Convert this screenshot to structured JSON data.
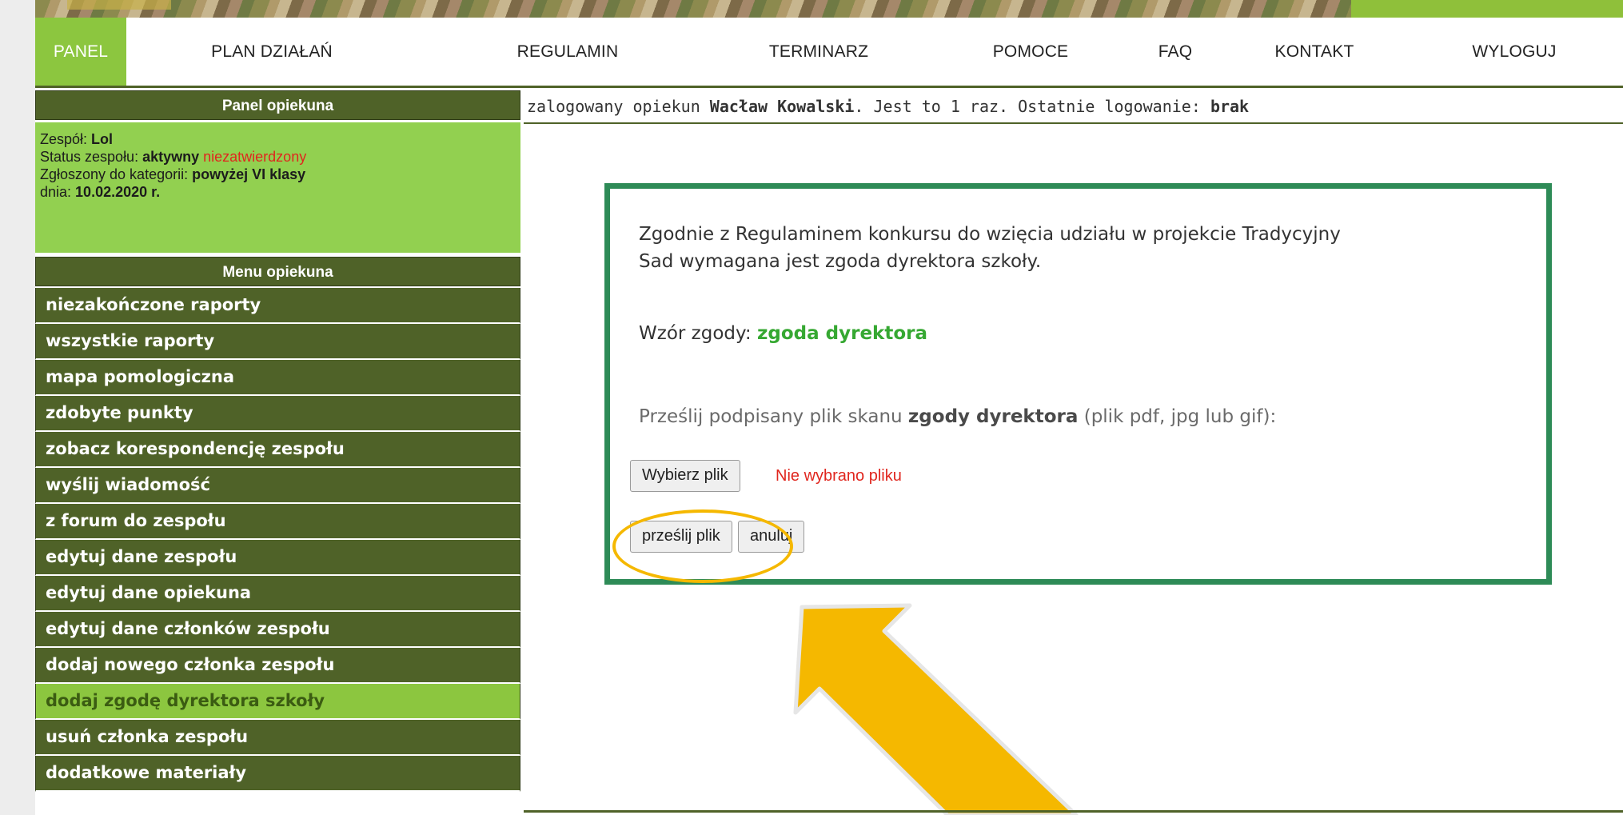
{
  "nav": {
    "items": [
      {
        "label": "PANEL",
        "active": true
      },
      {
        "label": "PLAN DZIAŁAŃ",
        "active": false
      },
      {
        "label": "REGULAMIN",
        "active": false
      },
      {
        "label": "TERMINARZ",
        "active": false
      },
      {
        "label": "POMOCE",
        "active": false
      },
      {
        "label": "FAQ",
        "active": false
      },
      {
        "label": "KONTAKT",
        "active": false
      },
      {
        "label": "WYLOGUJ",
        "active": false
      }
    ]
  },
  "sidebar": {
    "panel_title": "Panel opiekuna",
    "team_label": "Zespół: ",
    "team_name": "Lol",
    "status_label": "Status zespołu: ",
    "status_active": "aktywny",
    "status_unconfirmed": "niezatwierdzony",
    "category_label": "Zgłoszony do kategorii: ",
    "category_value": "powyżej VI klasy",
    "date_label": "dnia: ",
    "date_value": "10.02.2020 r.",
    "menu_title": "Menu opiekuna",
    "menu_items": [
      {
        "label": "niezakończone raporty",
        "active": false
      },
      {
        "label": "wszystkie raporty",
        "active": false
      },
      {
        "label": "mapa pomologiczna",
        "active": false
      },
      {
        "label": "zdobyte punkty",
        "active": false
      },
      {
        "label": "zobacz korespondencję zespołu",
        "active": false
      },
      {
        "label": "wyślij wiadomość",
        "active": false
      },
      {
        "label": "z forum do zespołu",
        "active": false
      },
      {
        "label": "edytuj dane zespołu",
        "active": false
      },
      {
        "label": "edytuj dane opiekuna",
        "active": false
      },
      {
        "label": "edytuj dane członków zespołu",
        "active": false
      },
      {
        "label": "dodaj nowego członka zespołu",
        "active": false
      },
      {
        "label": "dodaj zgodę dyrektora szkoły",
        "active": true
      },
      {
        "label": "usuń członka zespołu",
        "active": false
      },
      {
        "label": "dodatkowe materiały",
        "active": false
      }
    ]
  },
  "status": {
    "prefix": "zalogowany opiekun ",
    "user": "Wacław Kowalski",
    "middle": ". Jest to 1 raz. Ostatnie logowanie: ",
    "last_login": "brak"
  },
  "content": {
    "intro_line1": "Zgodnie z Regulaminem konkursu do wzięcia udziału w projekcie Tradycyjny",
    "intro_line2": "Sad wymagana jest zgoda dyrektora szkoły.",
    "template_label": "Wzór zgody: ",
    "template_link": "zgoda dyrektora",
    "upload_prefix": "Prześlij podpisany plik skanu ",
    "upload_bold": "zgody dyrektora",
    "upload_suffix": " (plik pdf, jpg lub gif):",
    "choose_file_button": "Wybierz plik",
    "no_file_text": "Nie wybrano pliku",
    "submit_button": "prześlij plik",
    "cancel_button": "anuluj"
  },
  "colors": {
    "nav_active": "#8cc63f",
    "sidebar_dark": "#4f6228",
    "info_box": "#92d050",
    "frame_green": "#2e8b57",
    "highlight": "#f5b800",
    "error_red": "#e0261e"
  }
}
